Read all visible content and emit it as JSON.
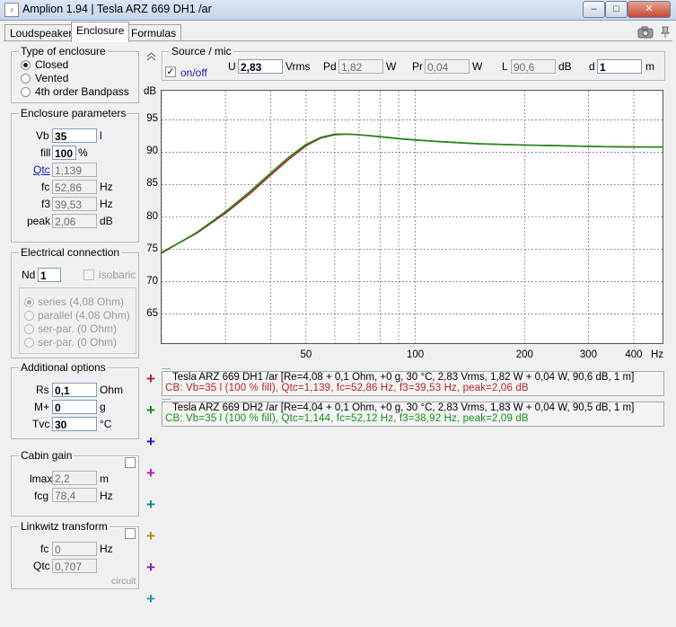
{
  "window": {
    "title": "Amplion 1.94 | Tesla ARZ 669 DH1 /ar",
    "buttons": {
      "minimize": "–",
      "maximize": "□",
      "close": "✕"
    }
  },
  "tabs": [
    {
      "label": "Loudspeaker"
    },
    {
      "label": "Enclosure"
    },
    {
      "label": "Formulas"
    }
  ],
  "toolbar": {
    "camera_icon": "camera-icon",
    "pin_icon": "pin-icon"
  },
  "enclosure_type": {
    "title": "Type of enclosure",
    "options": [
      {
        "label": "Closed",
        "selected": true
      },
      {
        "label": "Vented",
        "selected": false
      },
      {
        "label": "4th order Bandpass",
        "selected": false
      }
    ]
  },
  "enclosure_params": {
    "title": "Enclosure parameters",
    "vb": {
      "label": "Vb",
      "value": "35",
      "unit": "l"
    },
    "fill": {
      "label": "fill",
      "value": "100",
      "unit": "%"
    },
    "qtc": {
      "label": "Qtc",
      "value": "1,139"
    },
    "fc": {
      "label": "fc",
      "value": "52,86",
      "unit": "Hz"
    },
    "f3": {
      "label": "f3",
      "value": "39,53",
      "unit": "Hz"
    },
    "peak": {
      "label": "peak",
      "value": "2,06",
      "unit": "dB"
    }
  },
  "electrical": {
    "title": "Electrical connection",
    "nd": {
      "label": "Nd",
      "value": "1"
    },
    "isobaric": {
      "label": "isobaric",
      "checked": false
    },
    "options": [
      {
        "label": "series (4,08 Ohm)",
        "selected": true
      },
      {
        "label": "parallel (4,08 Ohm)",
        "selected": false
      },
      {
        "label": "ser-par. (0 Ohm)",
        "selected": false
      },
      {
        "label": "ser-par. (0 Ohm)",
        "selected": false
      }
    ]
  },
  "additional": {
    "title": "Additional options",
    "rs": {
      "label": "Rs",
      "value": "0,1",
      "unit": "Ohm"
    },
    "m": {
      "label": "M+",
      "value": "0",
      "unit": "g"
    },
    "tvc": {
      "label": "Tvc",
      "value": "30",
      "unit": "°C"
    }
  },
  "cabin": {
    "title": "Cabin gain",
    "lmax": {
      "label": "lmax",
      "value": "2,2",
      "unit": "m"
    },
    "fcg": {
      "label": "fcg",
      "value": "78,4",
      "unit": "Hz"
    }
  },
  "linkwitz": {
    "title": "Linkwitz transform",
    "fc": {
      "label": "fc",
      "value": "0",
      "unit": "Hz"
    },
    "qtc": {
      "label": "Qtc",
      "value": "0,707"
    },
    "circuit": "circuit"
  },
  "source": {
    "title": "Source / mic",
    "onoff": {
      "label": "on/off",
      "checked": true
    },
    "u": {
      "label": "U",
      "value": "2,83",
      "unit": "Vrms"
    },
    "pd": {
      "label": "Pd",
      "value": "1,82",
      "unit": "W"
    },
    "pr": {
      "label": "Pr",
      "value": "0,04",
      "unit": "W"
    },
    "l": {
      "label": "L",
      "value": "90,6",
      "unit": "dB"
    },
    "d": {
      "label": "d",
      "value": "1",
      "unit": "m"
    }
  },
  "chart_data": {
    "type": "line",
    "ylabel": "dB",
    "xlabel": "Hz",
    "x_scale": "log",
    "xlim": [
      20,
      480
    ],
    "ylim": [
      60.5,
      99.5
    ],
    "y_ticks": [
      65,
      70,
      75,
      80,
      85,
      90,
      95
    ],
    "x_ticks": [
      {
        "value": 20,
        "label": ""
      },
      {
        "value": 30,
        "label": ""
      },
      {
        "value": 40,
        "label": ""
      },
      {
        "value": 50,
        "label": "50"
      },
      {
        "value": 60,
        "label": ""
      },
      {
        "value": 70,
        "label": ""
      },
      {
        "value": 80,
        "label": ""
      },
      {
        "value": 90,
        "label": ""
      },
      {
        "value": 100,
        "label": "100"
      },
      {
        "value": 200,
        "label": "200"
      },
      {
        "value": 300,
        "label": "300"
      },
      {
        "value": 400,
        "label": "400"
      }
    ],
    "grid": true,
    "series": [
      {
        "color": "#b22222",
        "x": [
          20,
          25,
          30,
          35,
          40,
          45,
          50,
          55,
          60,
          65,
          70,
          80,
          90,
          100,
          120,
          150,
          200,
          250,
          300,
          400,
          480
        ],
        "y": [
          74.5,
          77.5,
          80.6,
          83.6,
          86.5,
          89.0,
          91.0,
          92.2,
          92.7,
          92.8,
          92.7,
          92.4,
          92.1,
          91.9,
          91.6,
          91.3,
          91.1,
          91.0,
          90.9,
          90.8,
          90.8
        ]
      },
      {
        "color": "#1a8a1a",
        "x": [
          20,
          25,
          30,
          35,
          40,
          45,
          50,
          55,
          60,
          65,
          70,
          80,
          90,
          100,
          120,
          150,
          200,
          250,
          300,
          400,
          480
        ],
        "y": [
          74.4,
          77.6,
          80.8,
          83.9,
          86.8,
          89.3,
          91.2,
          92.3,
          92.8,
          92.8,
          92.7,
          92.4,
          92.1,
          91.9,
          91.6,
          91.3,
          91.1,
          91.0,
          90.9,
          90.8,
          90.8
        ]
      }
    ]
  },
  "legend": [
    {
      "line1": "Tesla ARZ 669 DH1 /ar [Re=4,08 + 0,1 Ohm, +0 g, 30 °C, 2,83 Vrms, 1,82 W + 0,04 W, 90,6 dB, 1 m]",
      "line2": "CB: Vb=35 l (100 % fill), Qtc=1,139, fc=52,86 Hz, f3=39,53 Hz, peak=2,06 dB",
      "color": "#b22222"
    },
    {
      "line1": "Tesla ARZ 669 DH2 /ar [Re=4,04 + 0,1 Ohm, +0 g, 30 °C, 2,83 Vrms, 1,83 W + 0,04 W, 90,5 dB, 1 m]",
      "line2": "CB: Vb=35 l (100 % fill), Qtc=1,144, fc=52,12 Hz, f3=38,92 Hz, peak=2,09 dB",
      "color": "#1a8a1a"
    }
  ],
  "plus_buttons": [
    {
      "symbol": "+",
      "color": "#b22222"
    },
    {
      "symbol": "+",
      "color": "#1a8a1a"
    },
    {
      "symbol": "+",
      "color": "#1a1ab2"
    },
    {
      "symbol": "+",
      "color": "#b21ab2"
    },
    {
      "symbol": "+",
      "color": "#1a8a8a"
    },
    {
      "symbol": "+",
      "color": "#b28a1a"
    },
    {
      "symbol": "+",
      "color": "#8a1ab2"
    },
    {
      "symbol": "+",
      "color": "#1a9ab2"
    }
  ],
  "collapse_icon": "double-chevron-up-icon"
}
